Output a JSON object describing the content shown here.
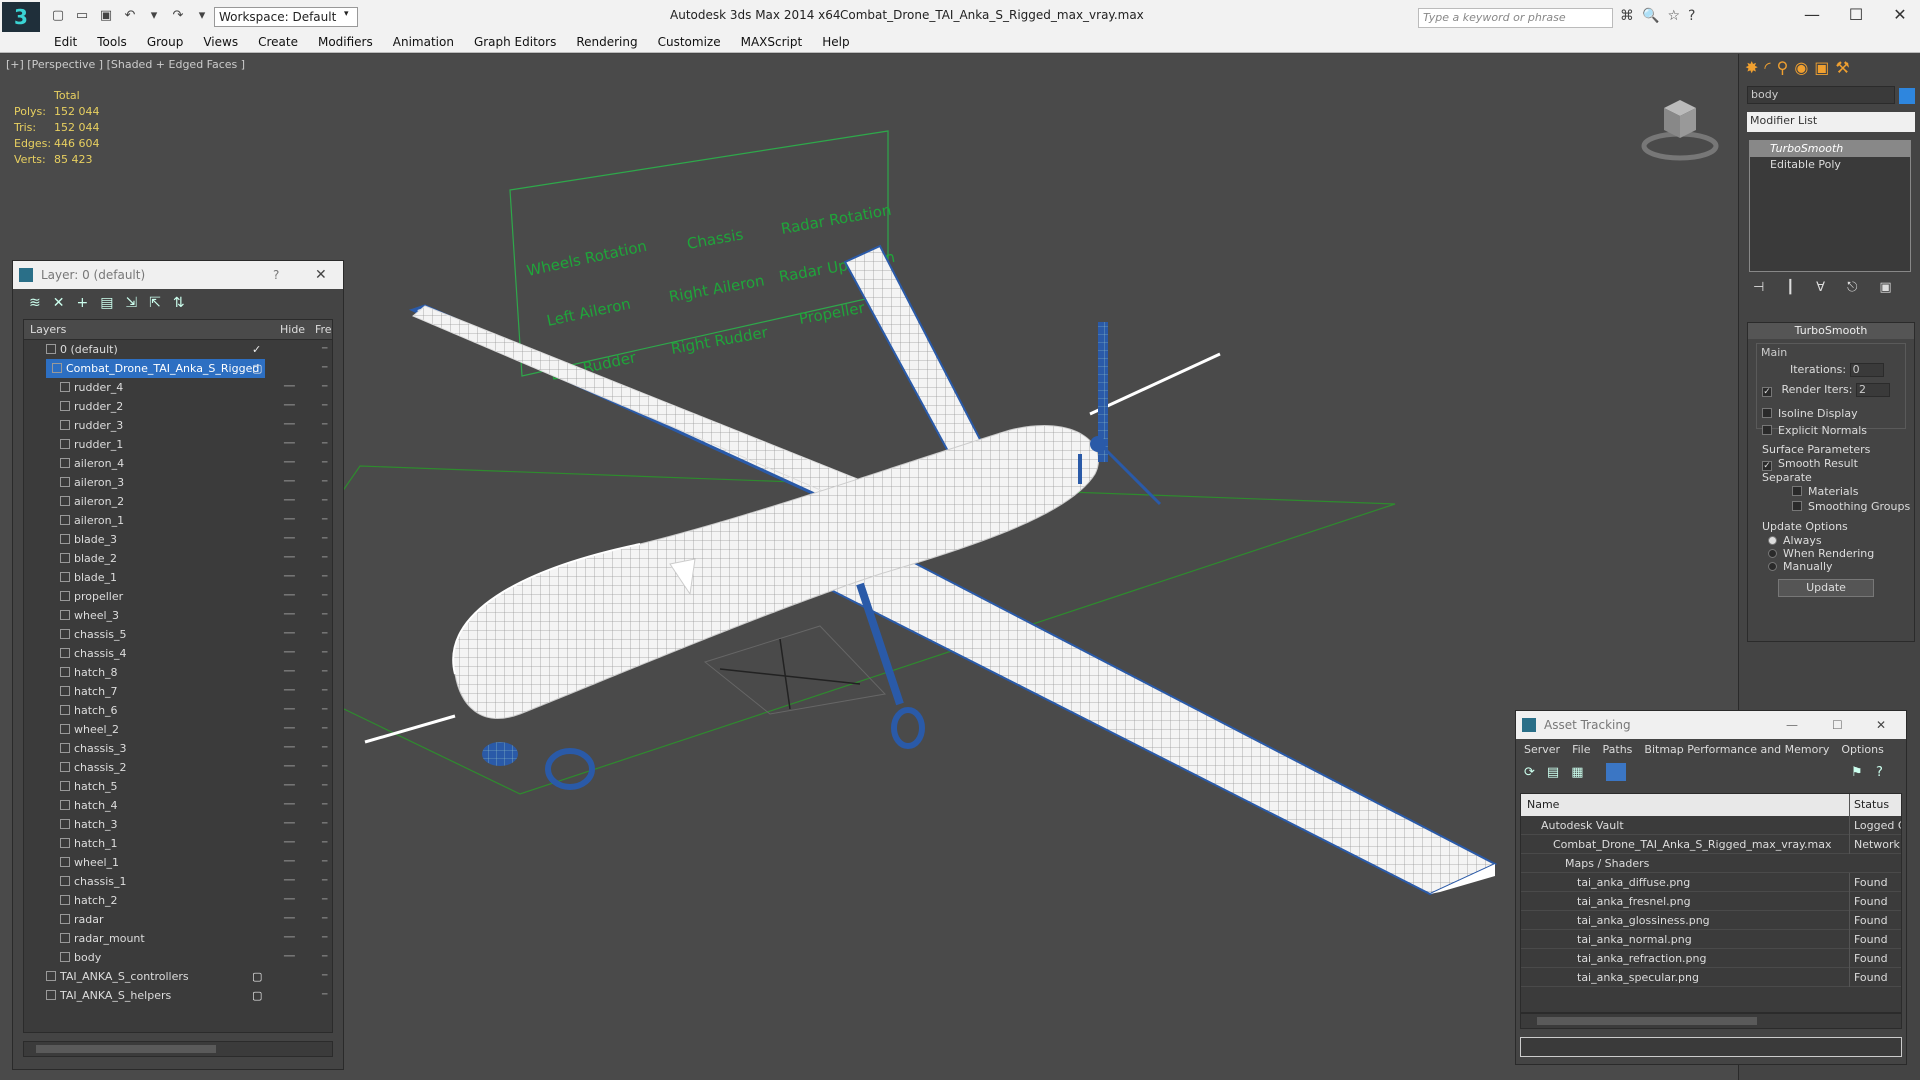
{
  "app": {
    "title": "Autodesk 3ds Max  2014 x64",
    "document": "Combat_Drone_TAI_Anka_S_Rigged_max_vray.max",
    "workspace": "Workspace: Default",
    "search_placeholder": "Type a keyword or phrase",
    "logo": "3",
    "window_buttons": [
      "—",
      "☐",
      "✕"
    ],
    "quick_access": [
      "▢",
      "▭",
      "▣",
      "↶",
      "▾",
      "↷",
      "▾",
      "▣"
    ],
    "search_icons": [
      "⌘",
      "🔍",
      "☆",
      "?"
    ]
  },
  "menu": [
    "Edit",
    "Tools",
    "Group",
    "Views",
    "Create",
    "Modifiers",
    "Animation",
    "Graph Editors",
    "Rendering",
    "Customize",
    "MAXScript",
    "Help"
  ],
  "viewport": {
    "label": "[+] [Perspective ] [Shaded + Edged Faces ]",
    "stats": {
      "header": "Total",
      "rows": [
        {
          "label": "Polys:",
          "value": "152 044"
        },
        {
          "label": "Tris:",
          "value": "152 044"
        },
        {
          "label": "Edges:",
          "value": "446 604"
        },
        {
          "label": "Verts:",
          "value": "85 423"
        }
      ]
    },
    "controller_labels": [
      "Wheels Rotation",
      "Chassis",
      "Radar Rotation",
      "Left Aileron",
      "Right Aileron",
      "Radar Up-Down",
      "Left Rudder",
      "Right Rudder",
      "Propeller"
    ]
  },
  "layer_window": {
    "title": "Layer: 0 (default)",
    "title_buttons": [
      "?",
      "✕"
    ],
    "toolbar": [
      "≋",
      "✕",
      "+",
      "▤",
      "⇲",
      "⇱",
      "⇅"
    ],
    "headers": {
      "layers": "Layers",
      "hide": "Hide",
      "freeze": "Fre"
    },
    "rows": [
      {
        "name": "0 (default)",
        "level": 0,
        "mark": "✓"
      },
      {
        "name": "Combat_Drone_TAI_Anka_S_Rigged",
        "level": 0,
        "selected": true,
        "mark": "▢"
      },
      {
        "name": "rudder_4",
        "level": 1
      },
      {
        "name": "rudder_2",
        "level": 1
      },
      {
        "name": "rudder_3",
        "level": 1
      },
      {
        "name": "rudder_1",
        "level": 1
      },
      {
        "name": "aileron_4",
        "level": 1
      },
      {
        "name": "aileron_3",
        "level": 1
      },
      {
        "name": "aileron_2",
        "level": 1
      },
      {
        "name": "aileron_1",
        "level": 1
      },
      {
        "name": "blade_3",
        "level": 1
      },
      {
        "name": "blade_2",
        "level": 1
      },
      {
        "name": "blade_1",
        "level": 1
      },
      {
        "name": "propeller",
        "level": 1
      },
      {
        "name": "wheel_3",
        "level": 1
      },
      {
        "name": "chassis_5",
        "level": 1
      },
      {
        "name": "chassis_4",
        "level": 1
      },
      {
        "name": "hatch_8",
        "level": 1
      },
      {
        "name": "hatch_7",
        "level": 1
      },
      {
        "name": "hatch_6",
        "level": 1
      },
      {
        "name": "wheel_2",
        "level": 1
      },
      {
        "name": "chassis_3",
        "level": 1
      },
      {
        "name": "chassis_2",
        "level": 1
      },
      {
        "name": "hatch_5",
        "level": 1
      },
      {
        "name": "hatch_4",
        "level": 1
      },
      {
        "name": "hatch_3",
        "level": 1
      },
      {
        "name": "hatch_1",
        "level": 1
      },
      {
        "name": "wheel_1",
        "level": 1
      },
      {
        "name": "chassis_1",
        "level": 1
      },
      {
        "name": "hatch_2",
        "level": 1
      },
      {
        "name": "radar",
        "level": 1
      },
      {
        "name": "radar_mount",
        "level": 1
      },
      {
        "name": "body",
        "level": 1
      },
      {
        "name": "TAI_ANKA_S_controllers",
        "level": 0,
        "mark": "▢"
      },
      {
        "name": "TAI_ANKA_S_helpers",
        "level": 0,
        "mark": "▢"
      }
    ]
  },
  "command_panel": {
    "tabs": [
      "✸",
      "◜",
      "⚲",
      "◉",
      "▣",
      "⚒"
    ],
    "object_name": "body",
    "object_color": "#2e86de",
    "modifier_list": "Modifier List",
    "stack": [
      "TurboSmooth",
      "Editable Poly"
    ],
    "stack_tools": [
      "⊣",
      "┃",
      "∀",
      "⎋",
      "▣"
    ],
    "rollout": {
      "title": "TurboSmooth",
      "main": "Main",
      "iterations_label": "Iterations:",
      "iterations": "0",
      "render_iters_label": "Render Iters:",
      "render_iters": "2",
      "isoline": "Isoline Display",
      "explicit": "Explicit Normals",
      "surface": "Surface Parameters",
      "smooth_result": "Smooth Result",
      "separate": "Separate",
      "materials": "Materials",
      "smoothing_groups": "Smoothing Groups",
      "update_options": "Update Options",
      "always": "Always",
      "when_rendering": "When Rendering",
      "manually": "Manually",
      "update": "Update"
    }
  },
  "asset_window": {
    "title": "Asset Tracking",
    "title_buttons": [
      "—",
      "☐",
      "✕"
    ],
    "menu": [
      "Server",
      "File",
      "Paths",
      "Bitmap Performance and Memory",
      "Options"
    ],
    "columns": {
      "name": "Name",
      "status": "Status"
    },
    "rows": [
      {
        "name": "Autodesk Vault",
        "status": "Logged C",
        "indent": 1
      },
      {
        "name": "Combat_Drone_TAI_Anka_S_Rigged_max_vray.max",
        "status": "Network",
        "indent": 2
      },
      {
        "name": "Maps / Shaders",
        "status": "",
        "indent": 3
      },
      {
        "name": "tai_anka_diffuse.png",
        "status": "Found",
        "indent": 4
      },
      {
        "name": "tai_anka_fresnel.png",
        "status": "Found",
        "indent": 4
      },
      {
        "name": "tai_anka_glossiness.png",
        "status": "Found",
        "indent": 4
      },
      {
        "name": "tai_anka_normal.png",
        "status": "Found",
        "indent": 4
      },
      {
        "name": "tai_anka_refraction.png",
        "status": "Found",
        "indent": 4
      },
      {
        "name": "tai_anka_specular.png",
        "status": "Found",
        "indent": 4
      }
    ]
  }
}
